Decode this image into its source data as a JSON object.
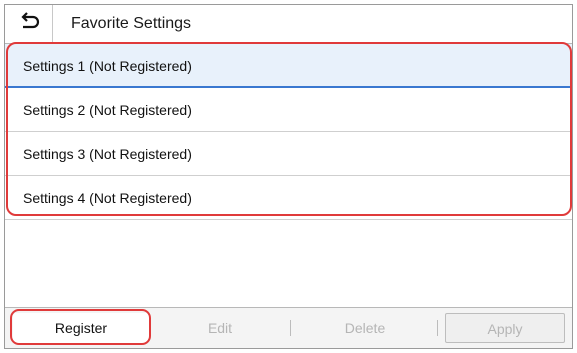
{
  "header": {
    "back_icon": "back-arrow-icon",
    "title": "Favorite Settings"
  },
  "settings_list": [
    {
      "label": "Settings 1 (Not Registered)",
      "selected": true
    },
    {
      "label": "Settings 2 (Not Registered)",
      "selected": false
    },
    {
      "label": "Settings 3 (Not Registered)",
      "selected": false
    },
    {
      "label": "Settings 4 (Not Registered)",
      "selected": false
    }
  ],
  "toolbar": {
    "register_label": "Register",
    "edit_label": "Edit",
    "delete_label": "Delete",
    "apply_label": "Apply"
  },
  "colors": {
    "selection_underline": "#3a78d0",
    "highlight_outline": "#e03a3a",
    "disabled_text": "#b5b5b5"
  }
}
